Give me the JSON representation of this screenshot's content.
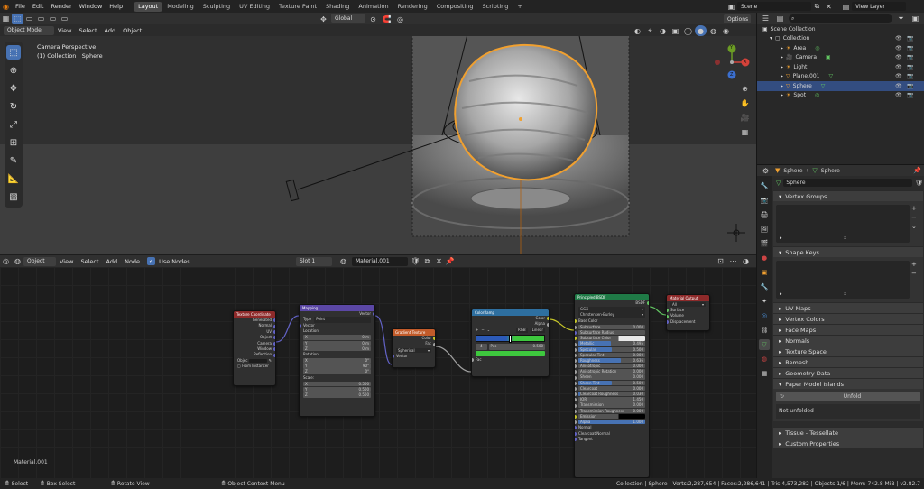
{
  "topbar": {
    "menus": [
      "File",
      "Edit",
      "Render",
      "Window",
      "Help"
    ],
    "workspaces": [
      "Layout",
      "Modeling",
      "Sculpting",
      "UV Editing",
      "Texture Paint",
      "Shading",
      "Animation",
      "Rendering",
      "Compositing",
      "Scripting"
    ],
    "active_workspace": "Layout",
    "add_tab": "+",
    "scene": "Scene",
    "view_layer": "View Layer"
  },
  "viewport_header": {
    "mode": "Object Mode",
    "menus": [
      "View",
      "Select",
      "Add",
      "Object"
    ],
    "orientation": "Global",
    "options": "Options"
  },
  "viewport": {
    "title": "Camera Perspective",
    "subtitle": "(1) Collection | Sphere",
    "gizmo": {
      "x": "X",
      "y": "Y",
      "z": "Z"
    },
    "colors": {
      "sphere_outline": "#f0a030",
      "bg": "#3c3c3c"
    }
  },
  "outliner": {
    "root": "Scene Collection",
    "collection": "Collection",
    "items": [
      {
        "name": "Area",
        "selected": false
      },
      {
        "name": "Camera",
        "selected": false
      },
      {
        "name": "Light",
        "selected": false
      },
      {
        "name": "Plane.001",
        "selected": false
      },
      {
        "name": "Sphere",
        "selected": true
      },
      {
        "name": "Spot",
        "selected": false
      }
    ]
  },
  "properties": {
    "breadcrumb_object": "Sphere",
    "breadcrumb_data": "Sphere",
    "data_name": "Sphere",
    "panels": {
      "vertex_groups": "Vertex Groups",
      "shape_keys": "Shape Keys",
      "uv_maps": "UV Maps",
      "vertex_colors": "Vertex Colors",
      "face_maps": "Face Maps",
      "normals": "Normals",
      "texture_space": "Texture Space",
      "remesh": "Remesh",
      "geometry_data": "Geometry Data",
      "paper_model": "Paper Model Islands",
      "tissue": "Tissue - Tessellate",
      "custom_props": "Custom Properties"
    },
    "unfold_button": "Unfold",
    "unfolded_status": "Not unfolded"
  },
  "node_editor_header": {
    "type": "Object",
    "menus": [
      "View",
      "Select",
      "Add",
      "Node"
    ],
    "use_nodes": "Use Nodes",
    "slot": "Slot 1",
    "material": "Material.001"
  },
  "node_editor": {
    "material_label": "Material.001",
    "nodes": {
      "texcoord": {
        "title": "Texture Coordinate",
        "outputs": [
          "Generated",
          "Normal",
          "UV",
          "Object",
          "Camera",
          "Window",
          "Reflection"
        ],
        "object_label": "Objec",
        "from_instancer": "From Instancer"
      },
      "mapping": {
        "title": "Mapping",
        "output": "Vector",
        "type_label": "Type",
        "type_value": "Point",
        "vector": "Vector",
        "location": "Location:",
        "loc": [
          {
            "a": "X",
            "v": "0 m"
          },
          {
            "a": "Y",
            "v": "0 m"
          },
          {
            "a": "Z",
            "v": "0 m"
          }
        ],
        "rotation": "Rotation:",
        "rot": [
          {
            "a": "X",
            "v": "0°"
          },
          {
            "a": "Y",
            "v": "90°"
          },
          {
            "a": "Z",
            "v": "0°"
          }
        ],
        "scale": "Scale:",
        "scl": [
          {
            "a": "X",
            "v": "0.500"
          },
          {
            "a": "Y",
            "v": "0.500"
          },
          {
            "a": "Z",
            "v": "0.500"
          }
        ]
      },
      "gradient": {
        "title": "Gradient Texture",
        "outputs": [
          "Color",
          "Fac"
        ],
        "type_value": "Spherical",
        "input": "Vector"
      },
      "colorramp": {
        "title": "ColorRamp",
        "outputs": [
          "Color",
          "Alpha"
        ],
        "mode": "RGB",
        "interp": "Linear",
        "index": "4",
        "pos_label": "Pos",
        "pos_value": "0.500",
        "input": "Fac"
      },
      "bsdf": {
        "title": "Principled BSDF",
        "output": "BSDF",
        "dist": "GGX",
        "sss": "Christensen-Burley",
        "inputs_plain_top": [
          "Base Color"
        ],
        "rows": [
          {
            "l": "Subsurface",
            "v": "0.000",
            "fill": 0,
            "blue": false
          },
          {
            "l": "Subsurface Radius",
            "v": "",
            "fill": 0,
            "blue": false
          },
          {
            "l": "Subsurface Color",
            "v": "",
            "fill": 0,
            "blue": false
          },
          {
            "l": "Metallic",
            "v": "0.495",
            "fill": 0.49,
            "blue": true
          },
          {
            "l": "Specular",
            "v": "0.500",
            "fill": 0.5,
            "blue": true
          },
          {
            "l": "Specular Tint",
            "v": "0.000",
            "fill": 0,
            "blue": false
          },
          {
            "l": "Roughness",
            "v": "0.636",
            "fill": 0.64,
            "blue": true
          },
          {
            "l": "Anisotropic",
            "v": "0.000",
            "fill": 0,
            "blue": false
          },
          {
            "l": "Anisotropic Rotation",
            "v": "0.000",
            "fill": 0,
            "blue": false
          },
          {
            "l": "Sheen",
            "v": "0.000",
            "fill": 0,
            "blue": false
          },
          {
            "l": "Sheen Tint",
            "v": "0.500",
            "fill": 0.5,
            "blue": true
          },
          {
            "l": "Clearcoat",
            "v": "0.000",
            "fill": 0,
            "blue": false
          },
          {
            "l": "Clearcoat Roughness",
            "v": "0.030",
            "fill": 0.03,
            "blue": false
          },
          {
            "l": "IOR",
            "v": "1.450",
            "fill": 0,
            "blue": false
          },
          {
            "l": "Transmission",
            "v": "0.000",
            "fill": 0,
            "blue": false
          },
          {
            "l": "Transmission Roughness",
            "v": "0.000",
            "fill": 0,
            "blue": false
          },
          {
            "l": "Emission",
            "v": "",
            "fill": 0,
            "blue": false
          },
          {
            "l": "Alpha",
            "v": "1.000",
            "fill": 1,
            "blue": true
          }
        ],
        "bottom_inputs": [
          "Normal",
          "Clearcoat Normal",
          "Tangent"
        ]
      },
      "output": {
        "title": "Material Output",
        "target": "All",
        "inputs": [
          "Surface",
          "Volume",
          "Displacement"
        ]
      }
    }
  },
  "statusbar": {
    "select": "Select",
    "box_select": "Box Select",
    "rotate_view": "Rotate View",
    "context_menu": "Object Context Menu",
    "stats": "Collection | Sphere | Verts:2,287,654 | Faces:2,286,641 | Tris:4,573,282 | Objects:1/6 | Mem: 742.8 MiB | v2.82.7"
  }
}
